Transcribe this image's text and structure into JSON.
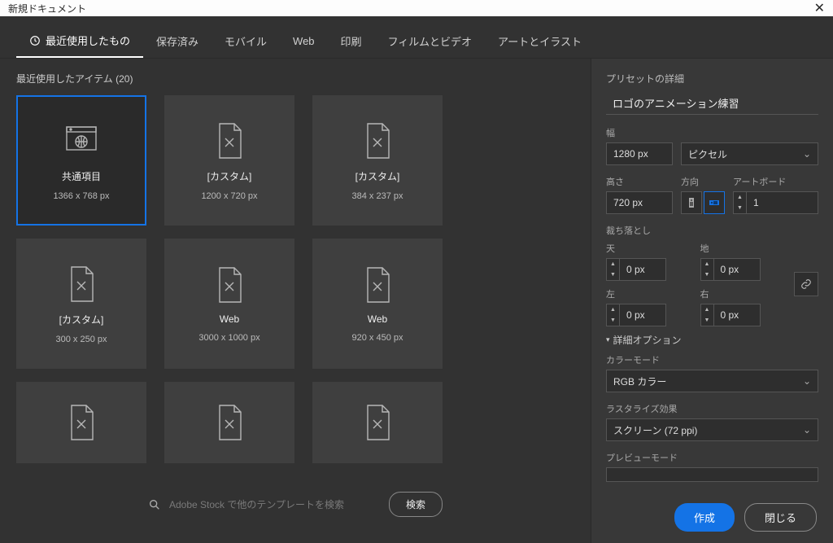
{
  "titlebar": {
    "title": "新規ドキュメント"
  },
  "tabs": [
    {
      "label": "最近使用したもの",
      "active": true,
      "hasIcon": true
    },
    {
      "label": "保存済み"
    },
    {
      "label": "モバイル"
    },
    {
      "label": "Web"
    },
    {
      "label": "印刷"
    },
    {
      "label": "フィルムとビデオ"
    },
    {
      "label": "アートとイラスト"
    }
  ],
  "recent": {
    "heading": "最近使用したアイテム (20)",
    "cards": [
      {
        "name": "共通項目",
        "dims": "1366 x 768 px",
        "icon": "globe",
        "selected": true
      },
      {
        "name": "[カスタム]",
        "dims": "1200 x 720 px",
        "icon": "custom"
      },
      {
        "name": "[カスタム]",
        "dims": "384 x 237 px",
        "icon": "custom"
      },
      {
        "name": "[カスタム]",
        "dims": "300 x 250 px",
        "icon": "custom"
      },
      {
        "name": "Web",
        "dims": "3000 x 1000 px",
        "icon": "custom"
      },
      {
        "name": "Web",
        "dims": "920 x 450 px",
        "icon": "custom"
      }
    ],
    "partialCount": 3
  },
  "search": {
    "placeholder": "Adobe Stock で他のテンプレートを検索",
    "button": "検索"
  },
  "preset": {
    "panelTitle": "プリセットの詳細",
    "name": "ロゴのアニメーション練習",
    "widthLabel": "幅",
    "widthValue": "1280 px",
    "unit": "ピクセル",
    "heightLabel": "高さ",
    "heightValue": "720 px",
    "orientationLabel": "方向",
    "artboardLabel": "アートボード",
    "artboardCount": "1",
    "bleedHeading": "裁ち落とし",
    "bleed": {
      "topLabel": "天",
      "top": "0 px",
      "bottomLabel": "地",
      "bottom": "0 px",
      "leftLabel": "左",
      "left": "0 px",
      "rightLabel": "右",
      "right": "0 px"
    },
    "advancedHeading": "詳細オプション",
    "colorModeLabel": "カラーモード",
    "colorMode": "RGB カラー",
    "rasterLabel": "ラスタライズ効果",
    "raster": "スクリーン (72 ppi)",
    "previewLabel": "プレビューモード"
  },
  "footer": {
    "create": "作成",
    "close": "閉じる"
  }
}
